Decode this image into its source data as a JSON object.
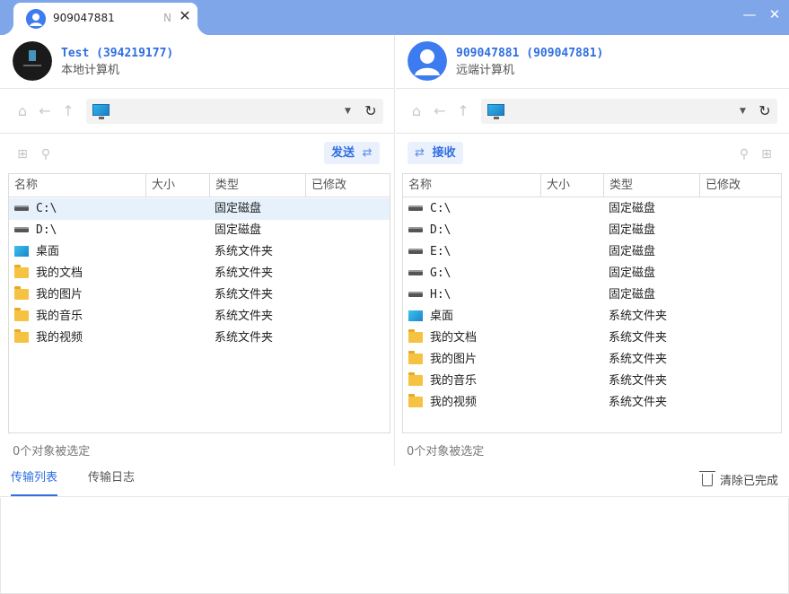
{
  "titlebar": {
    "tab_title": "909047881",
    "tab_extra": "N",
    "close_glyph": "✕",
    "minimize_glyph": "—",
    "window_close_glyph": "✕",
    "color": "#7fa6e8"
  },
  "local": {
    "name": "Test (394219177)",
    "subtitle": "本地计算机",
    "send_label": "发送",
    "status": "0个对象被选定",
    "columns": [
      "名称",
      "大小",
      "类型",
      "已修改"
    ],
    "rows": [
      {
        "name": "C:\\",
        "type": "固定磁盘",
        "icon": "drive-icon",
        "selected": true
      },
      {
        "name": "D:\\",
        "type": "固定磁盘",
        "icon": "drive-icon"
      },
      {
        "name": "桌面",
        "type": "系统文件夹",
        "icon": "desktop-icon"
      },
      {
        "name": "我的文档",
        "type": "系统文件夹",
        "icon": "folder-icon"
      },
      {
        "name": "我的图片",
        "type": "系统文件夹",
        "icon": "folder-icon"
      },
      {
        "name": "我的音乐",
        "type": "系统文件夹",
        "icon": "folder-icon"
      },
      {
        "name": "我的视频",
        "type": "系统文件夹",
        "icon": "folder-icon"
      }
    ]
  },
  "remote": {
    "name": "909047881 (909047881)",
    "subtitle": "远端计算机",
    "receive_label": "接收",
    "status": "0个对象被选定",
    "columns": [
      "名称",
      "大小",
      "类型",
      "已修改"
    ],
    "rows": [
      {
        "name": "C:\\",
        "type": "固定磁盘",
        "icon": "drive-icon"
      },
      {
        "name": "D:\\",
        "type": "固定磁盘",
        "icon": "drive-icon"
      },
      {
        "name": "E:\\",
        "type": "固定磁盘",
        "icon": "drive-icon"
      },
      {
        "name": "G:\\",
        "type": "固定磁盘",
        "icon": "drive-icon"
      },
      {
        "name": "H:\\",
        "type": "固定磁盘",
        "icon": "drive-icon"
      },
      {
        "name": "桌面",
        "type": "系统文件夹",
        "icon": "desktop-icon"
      },
      {
        "name": "我的文档",
        "type": "系统文件夹",
        "icon": "folder-icon"
      },
      {
        "name": "我的图片",
        "type": "系统文件夹",
        "icon": "folder-icon"
      },
      {
        "name": "我的音乐",
        "type": "系统文件夹",
        "icon": "folder-icon"
      },
      {
        "name": "我的视频",
        "type": "系统文件夹",
        "icon": "folder-icon"
      }
    ]
  },
  "bottom": {
    "tab_transfer_list": "传输列表",
    "tab_transfer_log": "传输日志",
    "clear_label": "清除已完成"
  },
  "accent": "#2f6ee0"
}
